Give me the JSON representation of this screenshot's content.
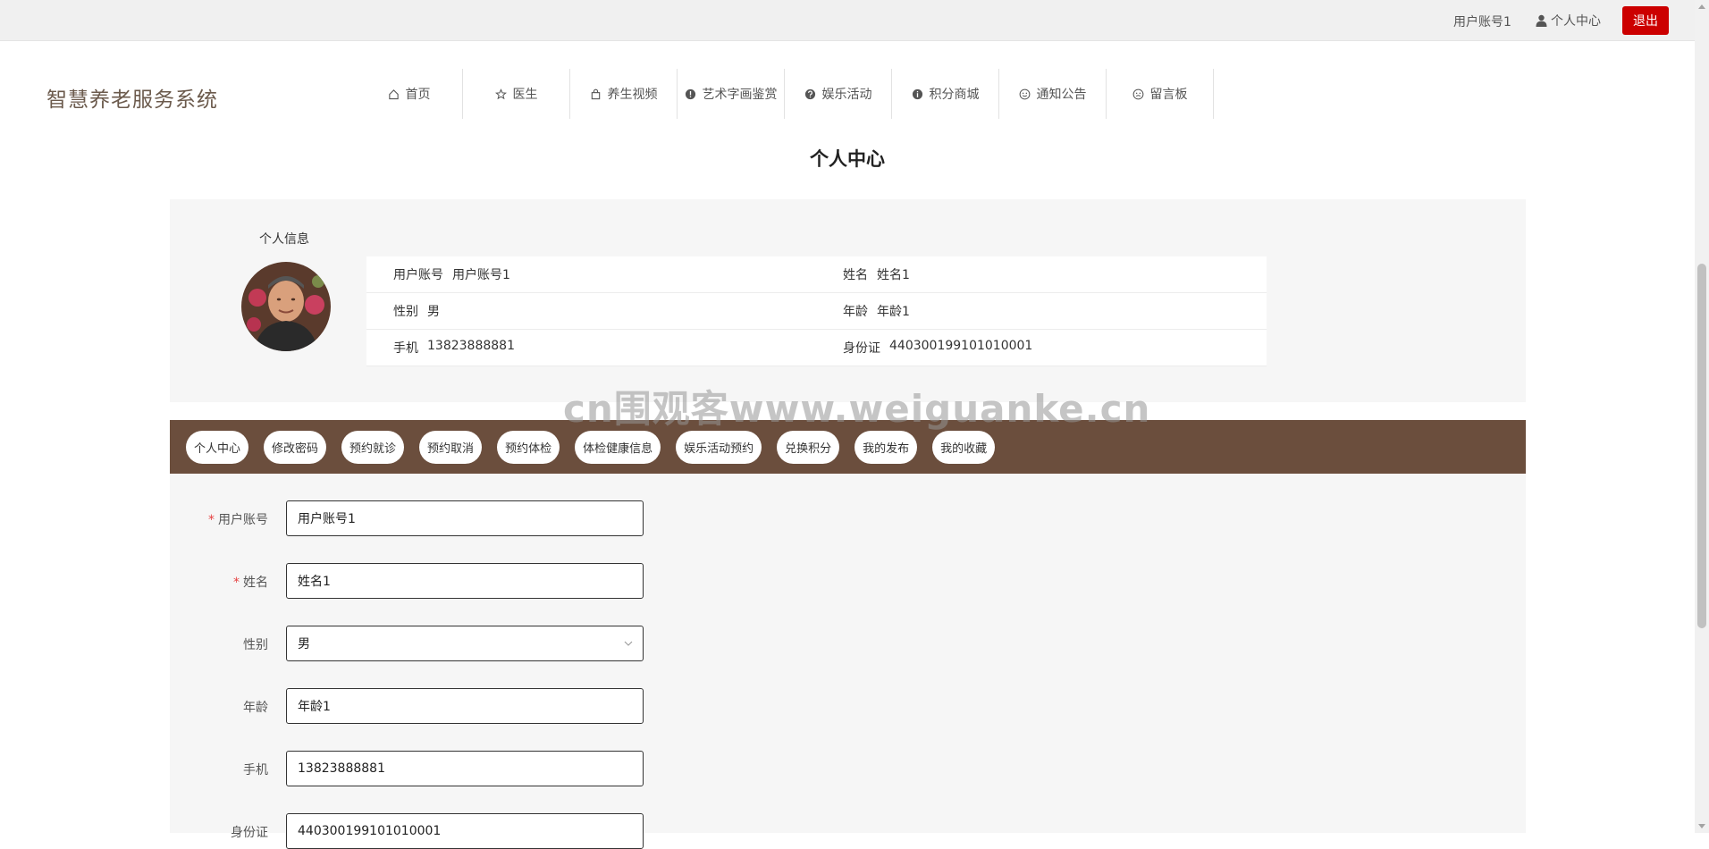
{
  "topbar": {
    "account": "用户账号1",
    "center": "个人中心",
    "logout": "退出"
  },
  "logo": "智慧养老服务系统",
  "nav": [
    {
      "label": "首页",
      "icon": "home-icon"
    },
    {
      "label": "医生",
      "icon": "star-icon"
    },
    {
      "label": "养生视频",
      "icon": "bag-icon"
    },
    {
      "label": "艺术字画鉴赏",
      "icon": "alert-icon"
    },
    {
      "label": "娱乐活动",
      "icon": "question-icon"
    },
    {
      "label": "积分商城",
      "icon": "info-icon"
    },
    {
      "label": "通知公告",
      "icon": "smile-icon"
    },
    {
      "label": "留言板",
      "icon": "meh-icon"
    }
  ],
  "page_title": "个人中心",
  "profile": {
    "section_label": "个人信息",
    "rows": [
      [
        {
          "label": "用户账号",
          "value": "用户账号1"
        },
        {
          "label": "姓名",
          "value": "姓名1"
        }
      ],
      [
        {
          "label": "性别",
          "value": "男"
        },
        {
          "label": "年龄",
          "value": "年龄1"
        }
      ],
      [
        {
          "label": "手机",
          "value": "13823888881"
        },
        {
          "label": "身份证",
          "value": "440300199101010001"
        }
      ]
    ]
  },
  "watermark": "cn围观客www.weiguanke.cn",
  "tabs": [
    "个人中心",
    "修改密码",
    "预约就诊",
    "预约取消",
    "预约体检",
    "体检健康信息",
    "娱乐活动预约",
    "兑换积分",
    "我的发布",
    "我的收藏"
  ],
  "form": {
    "fields": [
      {
        "label": "用户账号",
        "value": "用户账号1",
        "required": true,
        "type": "input"
      },
      {
        "label": "姓名",
        "value": "姓名1",
        "required": true,
        "type": "input"
      },
      {
        "label": "性别",
        "value": "男",
        "required": false,
        "type": "select"
      },
      {
        "label": "年龄",
        "value": "年龄1",
        "required": false,
        "type": "input"
      },
      {
        "label": "手机",
        "value": "13823888881",
        "required": false,
        "type": "input"
      },
      {
        "label": "身份证",
        "value": "440300199101010001",
        "required": false,
        "type": "input"
      }
    ],
    "required_mark": "*"
  },
  "colors": {
    "tab_bar": "#6b4e3d",
    "logout": "#cc0000",
    "logo": "#6b5a4c"
  }
}
